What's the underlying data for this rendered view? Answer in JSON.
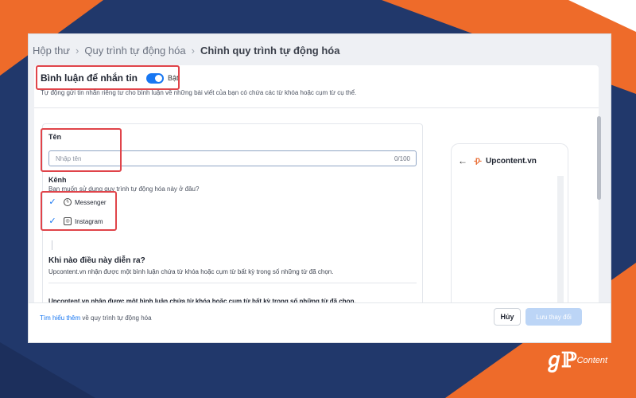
{
  "colors": {
    "navy": "#21386b",
    "orange": "#ee6b2a",
    "accent": "#1877f2",
    "highlight": "#e0444a"
  },
  "breadcrumb": {
    "items": [
      "Hộp thư",
      "Quy trình tự động hóa"
    ],
    "current": "Chỉnh quy trình tự động hóa"
  },
  "header": {
    "title": "Bình luận để nhắn tin",
    "toggle_label": "Bật",
    "toggle_on": true,
    "description": "Tự động gửi tin nhắn riêng tư cho bình luận về những bài viết của bạn có chứa các từ khóa hoặc cụm từ cụ thể."
  },
  "form": {
    "name_label": "Tên",
    "name_placeholder": "Nhập tên",
    "name_counter": "0/100",
    "channel_label": "Kênh",
    "channel_question": "Bạn muốn sử dụng quy trình tự động hóa này ở đâu?",
    "channels": [
      {
        "label": "Messenger",
        "checked": true,
        "icon": "messenger-icon"
      },
      {
        "label": "Instagram",
        "checked": true,
        "icon": "instagram-icon"
      }
    ],
    "when_title": "Khi nào điều này diễn ra?",
    "when_desc": "Upcontent.vn nhận được một bình luận chứa từ khóa hoặc cụm từ bất kỳ trong số những từ đã chọn.",
    "rule_text": "Upcontent.vn nhận được một bình luận chứa từ khóa hoặc cụm từ bất kỳ trong số những từ đã chọn."
  },
  "preview": {
    "page_name": "Upcontent.vn"
  },
  "footer": {
    "learn_link": "Tìm hiểu thêm",
    "learn_rest": " về quy trình tự động hóa",
    "cancel_label": "Hủy",
    "save_label": "Lưu thay đổi"
  },
  "brand": {
    "corner_text": "Content"
  }
}
